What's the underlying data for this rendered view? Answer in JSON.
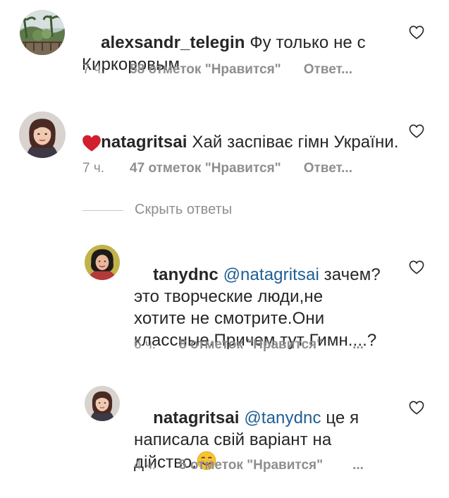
{
  "comments": [
    {
      "username": "alexsandr_telegin",
      "text": " Фу только не с\nКиркоровым",
      "time": "7 ч.",
      "likes": "58 отметок \"Нравится\"",
      "reply": "Ответ..."
    },
    {
      "username": "natagritsai",
      "text": " Хай заспіває гімн України.",
      "emoji": "red-heart",
      "time": "7 ч.",
      "likes": "47 отметок \"Нравится\"",
      "reply": "Ответ..."
    }
  ],
  "hide_replies_label": "Скрыть ответы",
  "replies": [
    {
      "username": "tanydnc",
      "mention": "@natagritsai",
      "text_first": " зачем?",
      "text_rest": "это творческие люди,не\nхотите не смотрите.Они\nклассные.Причем тут Гимн....?",
      "time": "6 ч.",
      "likes": "8 отметок \"Нравится\"",
      "more": "..."
    },
    {
      "username": "natagritsai",
      "mention": "@tanydnc",
      "text_first": " це я",
      "text_rest": "написала свій варіант на\nдійство.",
      "emoji": "smiling-face",
      "time": "4 ч.",
      "likes": "5 отметок \"Нравится\"",
      "more": "..."
    }
  ],
  "colors": {
    "username": "#262626",
    "mention": "#1f5e93",
    "meta": "#8e8e8e",
    "heart": "#ed4956"
  }
}
